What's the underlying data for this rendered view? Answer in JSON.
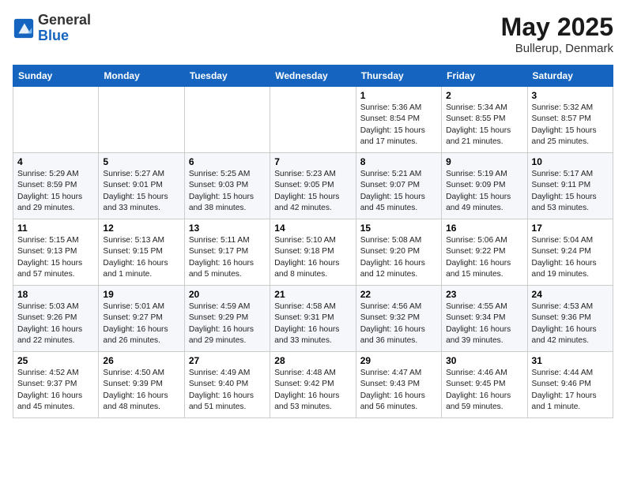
{
  "header": {
    "logo_general": "General",
    "logo_blue": "Blue",
    "title": "May 2025",
    "location": "Bullerup, Denmark"
  },
  "days_of_week": [
    "Sunday",
    "Monday",
    "Tuesday",
    "Wednesday",
    "Thursday",
    "Friday",
    "Saturday"
  ],
  "weeks": [
    [
      {
        "day": "",
        "text": ""
      },
      {
        "day": "",
        "text": ""
      },
      {
        "day": "",
        "text": ""
      },
      {
        "day": "",
        "text": ""
      },
      {
        "day": "1",
        "text": "Sunrise: 5:36 AM\nSunset: 8:54 PM\nDaylight: 15 hours and 17 minutes."
      },
      {
        "day": "2",
        "text": "Sunrise: 5:34 AM\nSunset: 8:55 PM\nDaylight: 15 hours and 21 minutes."
      },
      {
        "day": "3",
        "text": "Sunrise: 5:32 AM\nSunset: 8:57 PM\nDaylight: 15 hours and 25 minutes."
      }
    ],
    [
      {
        "day": "4",
        "text": "Sunrise: 5:29 AM\nSunset: 8:59 PM\nDaylight: 15 hours and 29 minutes."
      },
      {
        "day": "5",
        "text": "Sunrise: 5:27 AM\nSunset: 9:01 PM\nDaylight: 15 hours and 33 minutes."
      },
      {
        "day": "6",
        "text": "Sunrise: 5:25 AM\nSunset: 9:03 PM\nDaylight: 15 hours and 38 minutes."
      },
      {
        "day": "7",
        "text": "Sunrise: 5:23 AM\nSunset: 9:05 PM\nDaylight: 15 hours and 42 minutes."
      },
      {
        "day": "8",
        "text": "Sunrise: 5:21 AM\nSunset: 9:07 PM\nDaylight: 15 hours and 45 minutes."
      },
      {
        "day": "9",
        "text": "Sunrise: 5:19 AM\nSunset: 9:09 PM\nDaylight: 15 hours and 49 minutes."
      },
      {
        "day": "10",
        "text": "Sunrise: 5:17 AM\nSunset: 9:11 PM\nDaylight: 15 hours and 53 minutes."
      }
    ],
    [
      {
        "day": "11",
        "text": "Sunrise: 5:15 AM\nSunset: 9:13 PM\nDaylight: 15 hours and 57 minutes."
      },
      {
        "day": "12",
        "text": "Sunrise: 5:13 AM\nSunset: 9:15 PM\nDaylight: 16 hours and 1 minute."
      },
      {
        "day": "13",
        "text": "Sunrise: 5:11 AM\nSunset: 9:17 PM\nDaylight: 16 hours and 5 minutes."
      },
      {
        "day": "14",
        "text": "Sunrise: 5:10 AM\nSunset: 9:18 PM\nDaylight: 16 hours and 8 minutes."
      },
      {
        "day": "15",
        "text": "Sunrise: 5:08 AM\nSunset: 9:20 PM\nDaylight: 16 hours and 12 minutes."
      },
      {
        "day": "16",
        "text": "Sunrise: 5:06 AM\nSunset: 9:22 PM\nDaylight: 16 hours and 15 minutes."
      },
      {
        "day": "17",
        "text": "Sunrise: 5:04 AM\nSunset: 9:24 PM\nDaylight: 16 hours and 19 minutes."
      }
    ],
    [
      {
        "day": "18",
        "text": "Sunrise: 5:03 AM\nSunset: 9:26 PM\nDaylight: 16 hours and 22 minutes."
      },
      {
        "day": "19",
        "text": "Sunrise: 5:01 AM\nSunset: 9:27 PM\nDaylight: 16 hours and 26 minutes."
      },
      {
        "day": "20",
        "text": "Sunrise: 4:59 AM\nSunset: 9:29 PM\nDaylight: 16 hours and 29 minutes."
      },
      {
        "day": "21",
        "text": "Sunrise: 4:58 AM\nSunset: 9:31 PM\nDaylight: 16 hours and 33 minutes."
      },
      {
        "day": "22",
        "text": "Sunrise: 4:56 AM\nSunset: 9:32 PM\nDaylight: 16 hours and 36 minutes."
      },
      {
        "day": "23",
        "text": "Sunrise: 4:55 AM\nSunset: 9:34 PM\nDaylight: 16 hours and 39 minutes."
      },
      {
        "day": "24",
        "text": "Sunrise: 4:53 AM\nSunset: 9:36 PM\nDaylight: 16 hours and 42 minutes."
      }
    ],
    [
      {
        "day": "25",
        "text": "Sunrise: 4:52 AM\nSunset: 9:37 PM\nDaylight: 16 hours and 45 minutes."
      },
      {
        "day": "26",
        "text": "Sunrise: 4:50 AM\nSunset: 9:39 PM\nDaylight: 16 hours and 48 minutes."
      },
      {
        "day": "27",
        "text": "Sunrise: 4:49 AM\nSunset: 9:40 PM\nDaylight: 16 hours and 51 minutes."
      },
      {
        "day": "28",
        "text": "Sunrise: 4:48 AM\nSunset: 9:42 PM\nDaylight: 16 hours and 53 minutes."
      },
      {
        "day": "29",
        "text": "Sunrise: 4:47 AM\nSunset: 9:43 PM\nDaylight: 16 hours and 56 minutes."
      },
      {
        "day": "30",
        "text": "Sunrise: 4:46 AM\nSunset: 9:45 PM\nDaylight: 16 hours and 59 minutes."
      },
      {
        "day": "31",
        "text": "Sunrise: 4:44 AM\nSunset: 9:46 PM\nDaylight: 17 hours and 1 minute."
      }
    ]
  ]
}
